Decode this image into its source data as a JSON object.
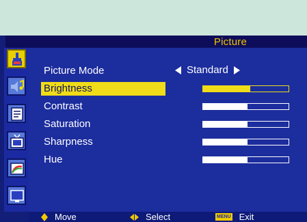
{
  "menu": {
    "title": "Picture"
  },
  "sidebar": {
    "items": [
      {
        "icon": "paintbrush-icon",
        "active": true
      },
      {
        "icon": "speaker-music-icon",
        "active": false
      },
      {
        "icon": "document-icon",
        "active": false
      },
      {
        "icon": "tv-antenna-icon",
        "active": false
      },
      {
        "icon": "picture-frame-icon",
        "active": false
      },
      {
        "icon": "monitor-icon",
        "active": false
      }
    ]
  },
  "picture_mode": {
    "label": "Picture Mode",
    "value": "Standard"
  },
  "settings": [
    {
      "label": "Brightness",
      "level": 0.55,
      "selected": true
    },
    {
      "label": "Contrast",
      "level": 0.52,
      "selected": false
    },
    {
      "label": "Saturation",
      "level": 0.52,
      "selected": false
    },
    {
      "label": "Sharpness",
      "level": 0.52,
      "selected": false
    },
    {
      "label": "Hue",
      "level": 0.52,
      "selected": false
    }
  ],
  "footer": {
    "move": "Move",
    "select": "Select",
    "menu_key": "MENU",
    "exit": "Exit"
  },
  "colors": {
    "panel": "#1c2d9e",
    "highlight": "#f0dc18",
    "header_text": "#f2c400"
  }
}
